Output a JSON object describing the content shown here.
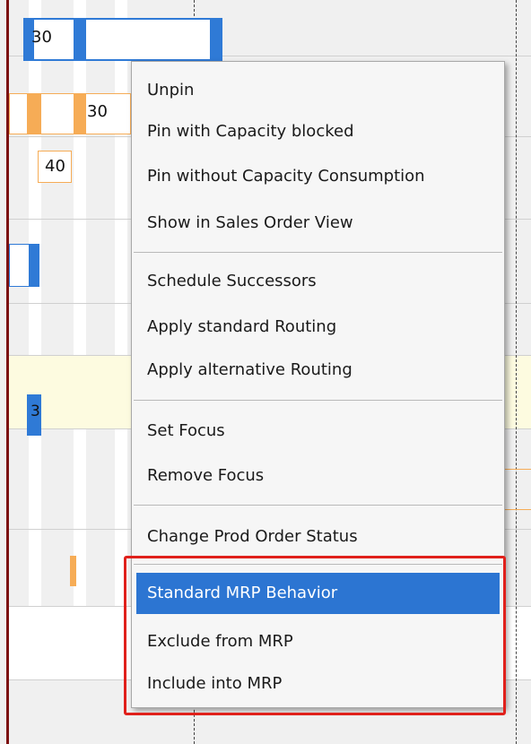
{
  "gantt": {
    "bar_labels": [
      "30",
      "30",
      "40",
      "3"
    ],
    "colors": {
      "blue": "#2f7ad6",
      "orange": "#f6ac56",
      "highlight_band": "#fdfbe0",
      "left_rule": "#7d1212"
    }
  },
  "context_menu": {
    "groups": [
      [
        "Unpin",
        "Pin with Capacity blocked",
        "Pin without Capacity Consumption",
        "Show in Sales Order View"
      ],
      [
        "Schedule Successors",
        "Apply standard Routing",
        "Apply alternative Routing"
      ],
      [
        "Set Focus",
        "Remove Focus"
      ],
      [
        "Change Prod Order Status"
      ],
      [
        "Standard MRP Behavior",
        "Exclude from MRP",
        "Include into MRP"
      ]
    ],
    "highlighted_item": "Standard MRP Behavior",
    "highlight_color": "#2c75d2",
    "callout_color": "#e0201b"
  }
}
